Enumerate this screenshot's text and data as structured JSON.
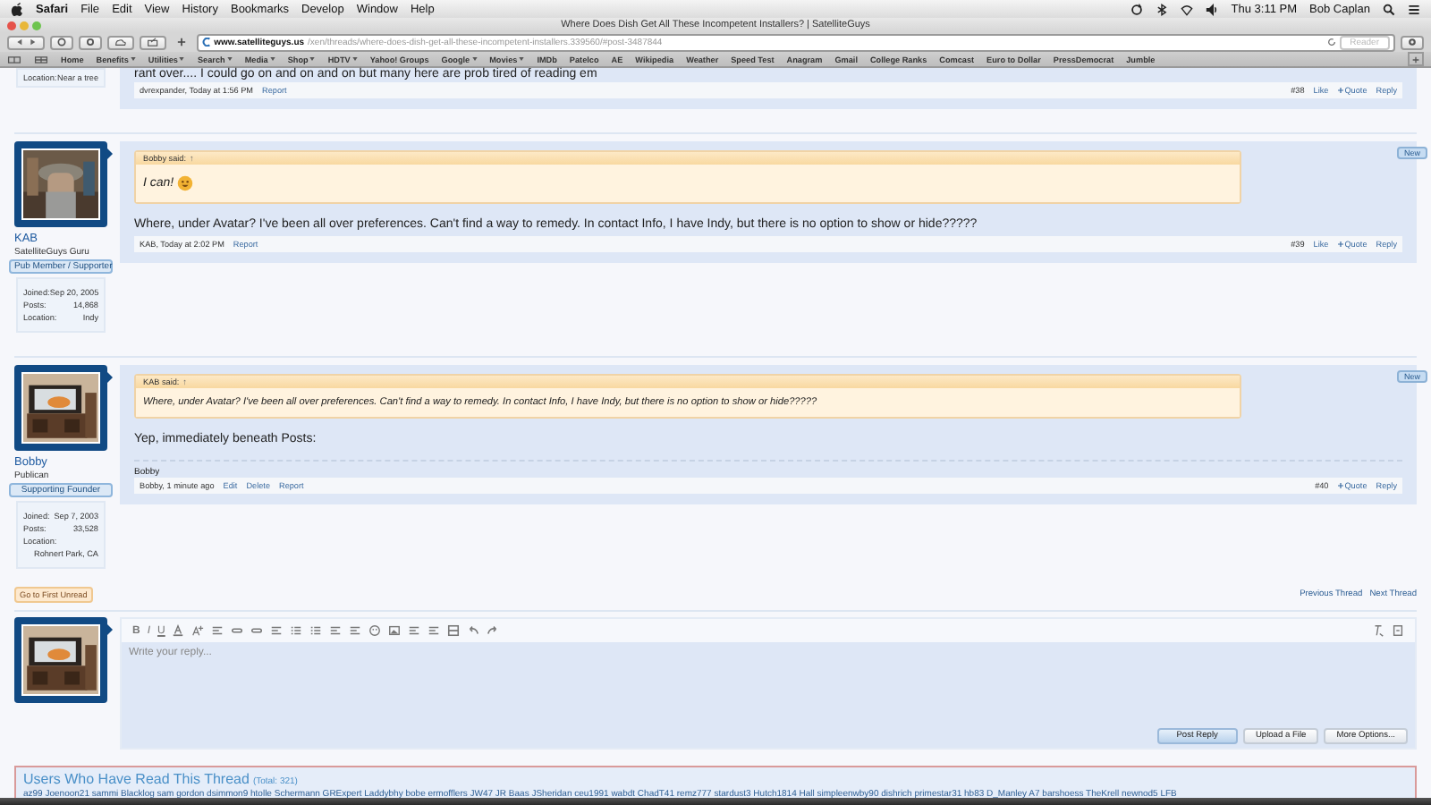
{
  "menubar": {
    "app": "Safari",
    "menus": [
      "File",
      "Edit",
      "View",
      "History",
      "Bookmarks",
      "Develop",
      "Window",
      "Help"
    ],
    "clock": "Thu 3:11 PM",
    "user": "Bob Caplan"
  },
  "window": {
    "title": "Where Does Dish Get All These Incompetent Installers? | SatelliteGuys",
    "url_host": "www.satelliteguys.us",
    "url_path": "/xen/threads/where-does-dish-get-all-these-incompetent-installers.339560/#post-3487844",
    "reader": "Reader"
  },
  "bookmarks": [
    {
      "label": "Home",
      "menu": false
    },
    {
      "label": "Benefits",
      "menu": true
    },
    {
      "label": "Utilities",
      "menu": true
    },
    {
      "label": "Search",
      "menu": true
    },
    {
      "label": "Media",
      "menu": true
    },
    {
      "label": "Shop",
      "menu": true
    },
    {
      "label": "HDTV",
      "menu": true
    },
    {
      "label": "Yahoo! Groups",
      "menu": false
    },
    {
      "label": "Google",
      "menu": true
    },
    {
      "label": "Movies",
      "menu": true
    },
    {
      "label": "IMDb",
      "menu": false
    },
    {
      "label": "Patelco",
      "menu": false
    },
    {
      "label": "AE",
      "menu": false
    },
    {
      "label": "Wikipedia",
      "menu": false
    },
    {
      "label": "Weather",
      "menu": false
    },
    {
      "label": "Speed Test",
      "menu": false
    },
    {
      "label": "Anagram",
      "menu": false
    },
    {
      "label": "Gmail",
      "menu": false
    },
    {
      "label": "College Ranks",
      "menu": false
    },
    {
      "label": "Comcast",
      "menu": false
    },
    {
      "label": "Euro to Dollar",
      "menu": false
    },
    {
      "label": "PressDemocrat",
      "menu": false
    },
    {
      "label": "Jumble",
      "menu": false
    }
  ],
  "posts": [
    {
      "user": {
        "stats": [
          {
            "label": "Location:",
            "value": "Near a tree",
            "wrap": false
          }
        ]
      },
      "message": "rant over.... I could go on and on and on but many here are prob tired of reading em",
      "meta": {
        "byline": "dvrexpander, Today at 1:56 PM",
        "links": [
          "Report"
        ]
      },
      "number": "#38",
      "actions": [
        "Like",
        "Quote",
        "Reply"
      ]
    },
    {
      "user": {
        "name": "KAB",
        "title": "SatelliteGuys Guru",
        "banner": "Pub Member / Supporter",
        "stats": [
          {
            "label": "Joined:",
            "value": "Sep 20, 2005",
            "wrap": false
          },
          {
            "label": "Posts:",
            "value": "14,868",
            "wrap": false
          },
          {
            "label": "Location:",
            "value": "Indy",
            "wrap": false
          }
        ]
      },
      "new_badge": "New",
      "quote": {
        "attribution": "Bobby said:",
        "arrow": "↑",
        "text": "I can!",
        "smiley": true
      },
      "message": "Where, under Avatar? I've been all over preferences. Can't find a way to remedy. In contact Info, I have Indy, but there is no option to show or hide?????",
      "meta": {
        "byline": "KAB, Today at 2:02 PM",
        "links": [
          "Report"
        ]
      },
      "number": "#39",
      "actions": [
        "Like",
        "Quote",
        "Reply"
      ]
    },
    {
      "user": {
        "name": "Bobby",
        "title": "Publican",
        "banner": "Supporting Founder",
        "stats": [
          {
            "label": "Joined:",
            "value": "Sep 7, 2003",
            "wrap": false
          },
          {
            "label": "Posts:",
            "value": "33,528",
            "wrap": false
          },
          {
            "label": "Location:",
            "value": "Rohnert Park, CA",
            "wrap": true
          }
        ]
      },
      "new_badge": "New",
      "quote": {
        "attribution": "KAB said:",
        "arrow": "↑",
        "text": "Where, under Avatar? I've been all over preferences. Can't find a way to remedy. In contact Info, I have Indy, but there is no option to show or hide?????",
        "smiley": false
      },
      "message": "Yep, immediately beneath Posts:",
      "signature": "Bobby",
      "meta": {
        "byline": "Bobby, 1 minute ago",
        "links": [
          "Edit",
          "Delete",
          "Report"
        ]
      },
      "number": "#40",
      "actions": [
        "Quote",
        "Reply"
      ]
    }
  ],
  "first_unread": "Go to First Unread",
  "thread_nav": [
    "Previous Thread",
    "Next Thread"
  ],
  "editor": {
    "format_buttons": [
      "B",
      "I",
      "U"
    ],
    "placeholder": "Write your reply...",
    "buttons": [
      {
        "label": "Post Reply",
        "primary": true
      },
      {
        "label": "Upload a File",
        "primary": false
      },
      {
        "label": "More Options...",
        "primary": false
      }
    ]
  },
  "readers": {
    "title": "Users Who Have Read This Thread",
    "total": "(Total: 321)",
    "names": "az99  Joenoon21  sammi  Blacklog  sam gordon  dsimmon9  htolle  Schermann  GRExpert  Laddybhy  bobe  ermofflers  JW47  JR Baas  JSheridan  ceu1991  wabdt  ChadT41  remz777  stardust3  Hutch1814  Hall  simpleenwby90  dishrich  primestar31  hb83  D_Manley  A7  barshoess  TheKrell  newnod5  LFB"
  }
}
